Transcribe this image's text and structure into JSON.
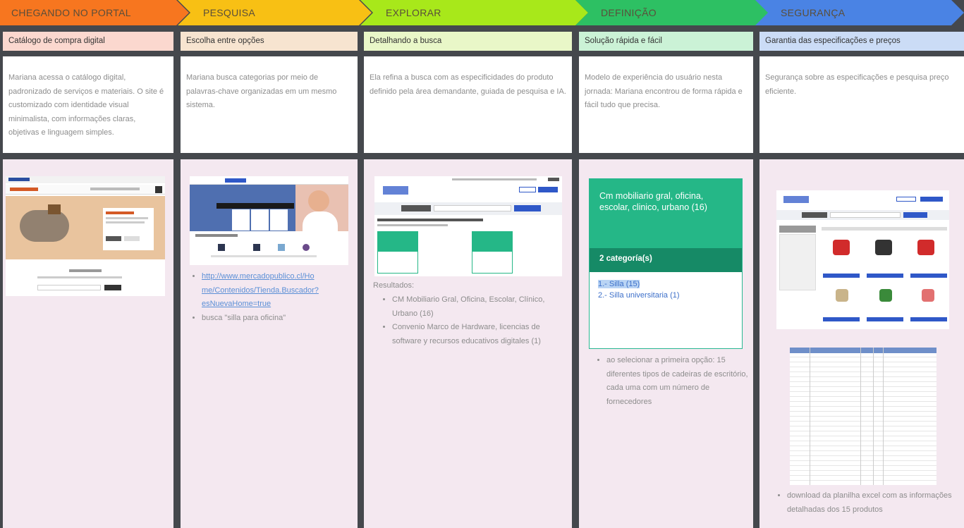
{
  "stages": [
    {
      "label": "CHEGANDO NO PORTAL",
      "color": "#f7761f"
    },
    {
      "label": "PESQUISA",
      "color": "#f8c014"
    },
    {
      "label": "EXPLORAR",
      "color": "#a8e81a"
    },
    {
      "label": "DEFINIÇÃO",
      "color": "#2dc063"
    },
    {
      "label": "SEGURANÇA",
      "color": "#4a83e4"
    }
  ],
  "columns": [
    {
      "subtitle": "Catálogo de compra digital",
      "subtitle_bg": "#fbd8cf",
      "description": "Mariana acessa o catálogo digital, padronizado de serviços e materiais. O site é customizado com identidade visual minimalista, com informações claras, objetivas e linguagem simples."
    },
    {
      "subtitle": "Escolha entre opções",
      "subtitle_bg": "#f7e4d0",
      "description": "Mariana busca categorias por meio de palavras-chave organizadas em um mesmo sistema.",
      "bullets": {
        "link": "http://www.mercadopublico.cl/Home/Contenidos/Tienda.Buscador?esNuevaHome=true",
        "link_lines": [
          "http://www.mercadopublico.cl/Ho",
          "me/Contenidos/Tienda.Buscador?",
          "esNuevaHome=true"
        ],
        "item2": "busca \"silla para oficina\""
      }
    },
    {
      "subtitle": "Detalhando a busca",
      "subtitle_bg": "#e9f7c8",
      "description": "Ela refina a busca com as especificidades do produto definido pela área demandante, guiada de pesquisa e IA.",
      "results_title": "Resultados:",
      "results": [
        "CM Mobiliario Gral, Oficina, Escolar, Clínico, Urbano (16)",
        "Convenio Marco de Hardware, licencias de software y recursos educativos digitales (1)"
      ]
    },
    {
      "subtitle": "Solução rápida e fácil",
      "subtitle_bg": "#cbf2d6",
      "description": "Modelo de experiência do usuário nesta jornada: Mariana encontrou de forma rápida e fácil tudo que precisa.",
      "card": {
        "title": "Cm mobiliario gral, oficina, escolar, clinico, urbano (16)",
        "categories": "2 categoría(s)",
        "item1": "1.- Silla (15)",
        "item2": "2.- Silla universitaria (1)"
      },
      "note": "ao selecionar a primeira opção: 15 diferentes tipos de cadeiras de escritório, cada uma com um número de fornecedores"
    },
    {
      "subtitle": "Garantia das especificações e preços",
      "subtitle_bg": "#cbdcf6",
      "description": "Segurança sobre as especificações e pesquisa preço eficiente.",
      "note": "download da planilha excel com as informações detalhadas dos 15 produtos"
    }
  ]
}
